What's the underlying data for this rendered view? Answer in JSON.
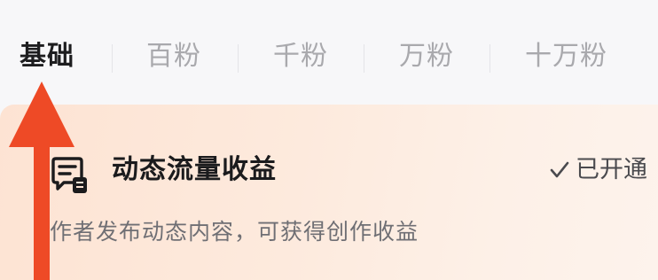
{
  "tabs": [
    {
      "label": "基础",
      "active": true
    },
    {
      "label": "百粉",
      "active": false
    },
    {
      "label": "千粉",
      "active": false
    },
    {
      "label": "万粉",
      "active": false
    },
    {
      "label": "十万粉",
      "active": false
    }
  ],
  "card": {
    "icon": "dynamic-feed-icon",
    "title": "动态流量收益",
    "status": "已开通",
    "status_icon": "check-icon",
    "description": "作者发布动态内容，可获得创作收益"
  },
  "annotation": {
    "icon": "up-arrow-icon",
    "color": "#ee4a26"
  },
  "colors": {
    "active_tab": "#1d1d1f",
    "inactive_tab": "#a9a9ad",
    "card_gradient_start": "#fde3d3",
    "card_gradient_end": "#fdf3ec"
  }
}
